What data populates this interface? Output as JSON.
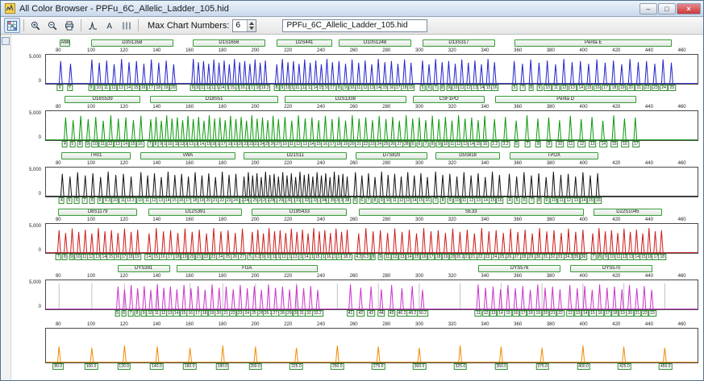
{
  "window": {
    "title": "All Color Browser - PPFu_6C_Allelic_Ladder_105.hid",
    "controls": {
      "minimize": "–",
      "maximize": "□",
      "close": "×"
    }
  },
  "toolbar": {
    "buttons": [
      {
        "name": "color-grid-button",
        "icon": "grid-icon",
        "pressed": true
      },
      {
        "sep": true
      },
      {
        "name": "zoom-in-button",
        "icon": "zoom-in-icon"
      },
      {
        "name": "zoom-out-button",
        "icon": "zoom-out-icon"
      },
      {
        "name": "print-button",
        "icon": "print-icon"
      },
      {
        "sep": true
      },
      {
        "name": "peak-pick-button",
        "icon": "peak-icon"
      },
      {
        "name": "label-button",
        "icon": "label-icon"
      },
      {
        "name": "chart-settings-button",
        "icon": "settings-icon"
      },
      {
        "sep": true
      }
    ],
    "max_chart_label": "Max Chart Numbers:",
    "max_chart_value": "6",
    "file_name": "PPFu_6C_Allelic_Ladder_105.hid"
  },
  "axis": {
    "bp_min": 72,
    "bp_max": 470,
    "ticks": [
      80,
      100,
      120,
      140,
      160,
      180,
      200,
      220,
      240,
      260,
      280,
      300,
      320,
      340,
      360,
      380,
      400,
      420,
      440,
      460
    ],
    "y_top": "5,000",
    "y_bottom": "0"
  },
  "channels": [
    {
      "id": "blue",
      "color": "#2323cc",
      "markers": [
        {
          "name": "AMEL",
          "start": 81,
          "end": 87,
          "alleles": [
            "X",
            "Y"
          ]
        },
        {
          "name": "D3S1358",
          "start": 100,
          "end": 150,
          "alleles": [
            "9",
            "10",
            "11",
            "12",
            "13",
            "14",
            "15",
            "16",
            "17",
            "18",
            "19",
            "20"
          ]
        },
        {
          "name": "D1S1656",
          "start": 162,
          "end": 206,
          "alleles": [
            "9",
            "10",
            "11",
            "12",
            "13",
            "14",
            "14.3",
            "15",
            "15.3",
            "16",
            "16.3",
            "17",
            "17.3",
            "18.3",
            "19.3"
          ]
        },
        {
          "name": "D2S441",
          "start": 213,
          "end": 247,
          "alleles": [
            "8",
            "9",
            "10",
            "11",
            "11.3",
            "12",
            "13",
            "14",
            "15",
            "16",
            "17"
          ]
        },
        {
          "name": "D10S1248",
          "start": 251,
          "end": 295,
          "alleles": [
            "8",
            "9",
            "10",
            "11",
            "12",
            "13",
            "14",
            "15",
            "16",
            "17",
            "18",
            "19"
          ]
        },
        {
          "name": "D13S317",
          "start": 302,
          "end": 346,
          "alleles": [
            "5",
            "6",
            "7",
            "8",
            "9",
            "10",
            "11",
            "12",
            "13",
            "14",
            "15",
            "16"
          ]
        },
        {
          "name": "Penta E",
          "start": 358,
          "end": 454,
          "alleles": [
            "5",
            "7",
            "8",
            "9",
            "10",
            "11",
            "12",
            "13",
            "14",
            "15",
            "16",
            "17",
            "18",
            "19",
            "20",
            "21",
            "22",
            "23",
            "24",
            "25"
          ]
        }
      ]
    },
    {
      "id": "green",
      "color": "#0a9a0a",
      "markers": [
        {
          "name": "D16S539",
          "start": 84,
          "end": 130,
          "alleles": [
            "4",
            "5",
            "8",
            "9",
            "10",
            "11",
            "12",
            "13",
            "14",
            "15",
            "16"
          ]
        },
        {
          "name": "D18S51",
          "start": 136,
          "end": 214,
          "alleles": [
            "7",
            "8",
            "9",
            "10",
            "10.2",
            "11",
            "12",
            "13",
            "13.2",
            "14",
            "14.2",
            "15",
            "16",
            "17",
            "17.2",
            "18",
            "19",
            "20",
            "21",
            "22",
            "23",
            "24",
            "25",
            "26",
            "27"
          ]
        },
        {
          "name": "D2S1338",
          "start": 218,
          "end": 292,
          "alleles": [
            "10",
            "11",
            "12",
            "13",
            "14",
            "15",
            "16",
            "17",
            "18",
            "19",
            "20",
            "21",
            "22",
            "23",
            "24",
            "25",
            "26",
            "27",
            "28"
          ]
        },
        {
          "name": "CSF1PO",
          "start": 296,
          "end": 340,
          "alleles": [
            "5",
            "6",
            "7",
            "8",
            "9",
            "10",
            "11",
            "12",
            "13",
            "14",
            "15",
            "16"
          ]
        },
        {
          "name": "Penta D",
          "start": 346,
          "end": 432,
          "alleles": [
            "2.2",
            "3.2",
            "5",
            "7",
            "8",
            "9",
            "10",
            "11",
            "12",
            "13",
            "14",
            "15",
            "16",
            "17"
          ]
        }
      ]
    },
    {
      "id": "black",
      "color": "#151515",
      "markers": [
        {
          "name": "TH01",
          "start": 82,
          "end": 124,
          "alleles": [
            "4",
            "5",
            "6",
            "7",
            "8",
            "9",
            "9.3",
            "10",
            "11",
            "13.3"
          ]
        },
        {
          "name": "vWA",
          "start": 130,
          "end": 188,
          "alleles": [
            "10",
            "11",
            "12",
            "13",
            "14",
            "15",
            "16",
            "17",
            "18",
            "19",
            "20",
            "21",
            "22",
            "23",
            "24"
          ]
        },
        {
          "name": "D21S11",
          "start": 193,
          "end": 256,
          "alleles": [
            "24",
            "24.2",
            "25",
            "25.2",
            "26",
            "27",
            "28",
            "28.2",
            "29",
            "29.2",
            "30",
            "30.2",
            "31",
            "31.2",
            "32",
            "32.2",
            "33",
            "33.2",
            "34",
            "34.2",
            "35",
            "35.2",
            "36",
            "37",
            "38"
          ]
        },
        {
          "name": "D7S820",
          "start": 261,
          "end": 305,
          "alleles": [
            "5",
            "6",
            "7",
            "8",
            "9",
            "10",
            "11",
            "12",
            "13",
            "14",
            "15",
            "16"
          ]
        },
        {
          "name": "D5S818",
          "start": 310,
          "end": 349,
          "alleles": [
            "7",
            "8",
            "9",
            "10",
            "11",
            "12",
            "13",
            "14",
            "15",
            "16"
          ]
        },
        {
          "name": "TPOX",
          "start": 355,
          "end": 409,
          "alleles": [
            "4",
            "5",
            "6",
            "7",
            "8",
            "9",
            "10",
            "11",
            "12",
            "13",
            "14",
            "15",
            "16"
          ]
        }
      ]
    },
    {
      "id": "red",
      "color": "#cf1a1a",
      "markers": [
        {
          "name": "D8S1179",
          "start": 80,
          "end": 128,
          "alleles": [
            "7",
            "8",
            "9",
            "10",
            "11",
            "12",
            "13",
            "14",
            "15",
            "16",
            "17",
            "18",
            "19"
          ]
        },
        {
          "name": "D12S391",
          "start": 135,
          "end": 192,
          "alleles": [
            "14",
            "15",
            "16",
            "17",
            "18",
            "19",
            "20",
            "21",
            "22",
            "23",
            "24",
            "25",
            "26",
            "27"
          ]
        },
        {
          "name": "D19S433",
          "start": 198,
          "end": 256,
          "alleles": [
            "5.2",
            "6.2",
            "9",
            "10",
            "11",
            "12",
            "12.2",
            "13",
            "13.2",
            "14",
            "14.2",
            "15",
            "15.2",
            "16",
            "16.2",
            "17",
            "17.2",
            "18.2"
          ]
        },
        {
          "name": "SE33",
          "start": 263,
          "end": 400,
          "alleles": [
            "4.2",
            "6.3",
            "8",
            "9",
            "11",
            "12",
            "13",
            "14",
            "15",
            "16",
            "17",
            "18",
            "19",
            "20",
            "20.2",
            "21",
            "21.2",
            "22.2",
            "23.2",
            "24.2",
            "25.2",
            "26.2",
            "27.2",
            "28.2",
            "29.2",
            "30.2",
            "31.2",
            "32.2",
            "33.2",
            "34.2",
            "35",
            "36"
          ]
        },
        {
          "name": "D22S1045",
          "start": 406,
          "end": 448,
          "alleles": [
            "7",
            "8",
            "9",
            "10",
            "11",
            "12",
            "13",
            "14",
            "15",
            "16",
            "17",
            "18"
          ]
        }
      ]
    },
    {
      "id": "magenta",
      "color": "#cc33cc",
      "ils_gridlines": true,
      "markers": [
        {
          "name": "DYS391",
          "start": 116,
          "end": 148,
          "alleles": [
            "5",
            "6",
            "7",
            "8",
            "9",
            "10",
            "11",
            "12",
            "13"
          ]
        },
        {
          "name": "FGA",
          "start": 152,
          "end": 238,
          "alleles": [
            "14",
            "15",
            "16",
            "17",
            "18",
            "19",
            "20",
            "21",
            "22",
            "23",
            "24",
            "25",
            "26",
            "26.2",
            "27",
            "28",
            "29",
            "30",
            "31.2",
            "32.2",
            "33.2"
          ]
        },
        {
          "name": "",
          "start": 258,
          "end": 302,
          "alleles": [
            "41",
            "42",
            "43",
            "44",
            "45",
            "46.2",
            "48.2",
            "50.2"
          ]
        },
        {
          "name": "DYS576",
          "start": 336,
          "end": 386,
          "alleles": [
            "11",
            "12",
            "13",
            "14",
            "15",
            "16",
            "17",
            "18",
            "19",
            "20",
            "21",
            "22"
          ]
        },
        {
          "name": "DYS570",
          "start": 392,
          "end": 442,
          "alleles": [
            "12",
            "13",
            "14",
            "15",
            "16",
            "17",
            "18",
            "19",
            "20",
            "21",
            "22",
            "23"
          ]
        }
      ]
    },
    {
      "id": "orange",
      "color": "#f28a00",
      "sizes": [
        {
          "bp": 80,
          "label": "80.0"
        },
        {
          "bp": 100,
          "label": "100.0"
        },
        {
          "bp": 120,
          "label": "120.0"
        },
        {
          "bp": 140,
          "label": "140.0"
        },
        {
          "bp": 160,
          "label": "160.0"
        },
        {
          "bp": 180,
          "label": "180.0"
        },
        {
          "bp": 200,
          "label": "200.0"
        },
        {
          "bp": 225,
          "label": "225.0"
        },
        {
          "bp": 250,
          "label": "250.0"
        },
        {
          "bp": 275,
          "label": "275.0"
        },
        {
          "bp": 300,
          "label": "300.0"
        },
        {
          "bp": 325,
          "label": "325.0"
        },
        {
          "bp": 350,
          "label": "350.0"
        },
        {
          "bp": 375,
          "label": "375.0"
        },
        {
          "bp": 400,
          "label": "400.0"
        },
        {
          "bp": 425,
          "label": "425.0"
        },
        {
          "bp": 450,
          "label": "450.0"
        }
      ]
    }
  ]
}
